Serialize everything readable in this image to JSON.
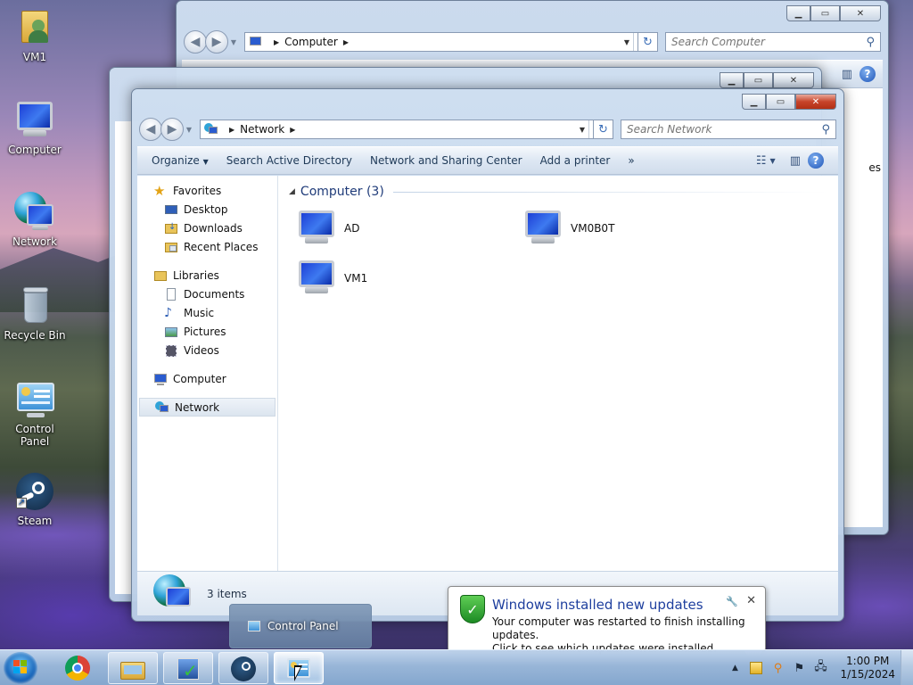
{
  "desktop": {
    "icons": [
      {
        "label": "VM1",
        "icon": "user-folder-icon"
      },
      {
        "label": "Computer",
        "icon": "computer-icon"
      },
      {
        "label": "Network",
        "icon": "network-icon"
      },
      {
        "label": "Recycle Bin",
        "icon": "recycle-bin-icon"
      },
      {
        "label": "Control Panel",
        "icon": "control-panel-icon"
      },
      {
        "label": "Steam",
        "icon": "steam-icon"
      }
    ]
  },
  "back_window": {
    "breadcrumb": "Computer",
    "search_placeholder": "Search Computer",
    "partial_text": "es"
  },
  "main_window": {
    "breadcrumb": "Network",
    "search_placeholder": "Search Network",
    "commands": {
      "organize": "Organize",
      "search_ad": "Search Active Directory",
      "network_sharing": "Network and Sharing Center",
      "add_printer": "Add a printer",
      "more": "»"
    },
    "nav": {
      "favorites": "Favorites",
      "desktop": "Desktop",
      "downloads": "Downloads",
      "recent_places": "Recent Places",
      "libraries": "Libraries",
      "documents": "Documents",
      "music": "Music",
      "pictures": "Pictures",
      "videos": "Videos",
      "computer": "Computer",
      "network": "Network"
    },
    "group_header": "Computer (3)",
    "items": [
      {
        "name": "AD"
      },
      {
        "name": "VM0B0T"
      },
      {
        "name": "VM1"
      }
    ],
    "status": "3 items"
  },
  "taskbar": {
    "thumbnail_label": "Control Panel",
    "time": "1:00 PM",
    "date": "1/15/2024"
  },
  "notification": {
    "title": "Windows installed new updates",
    "line1": "Your computer was restarted to finish installing updates.",
    "line2": "Click to see which updates were installed."
  },
  "colors": {
    "title_blue": "#1e3f9e",
    "group_header_blue": "#1f3b79",
    "close_red": "#c7442a"
  }
}
